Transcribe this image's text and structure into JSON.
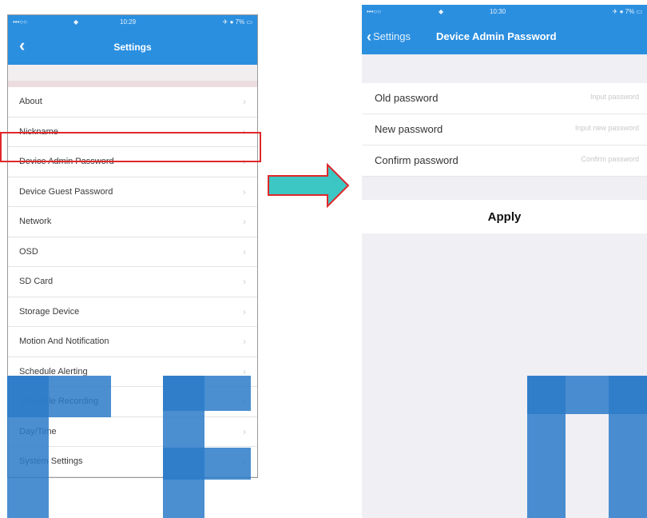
{
  "caption": "",
  "left_screen": {
    "status": {
      "carrier": "•••○○",
      "wifi": "◆",
      "time": "10:29",
      "battery": "✈ ● 7% ▭"
    },
    "nav": {
      "title": "Settings"
    },
    "items": [
      {
        "label": "About"
      },
      {
        "label": "Nickname"
      },
      {
        "label": "Device Admin Password"
      },
      {
        "label": "Device Guest Password"
      },
      {
        "label": "Network"
      },
      {
        "label": "OSD"
      },
      {
        "label": "SD Card"
      },
      {
        "label": "Storage Device"
      },
      {
        "label": "Motion And Notification"
      },
      {
        "label": "Schedule Alerting"
      },
      {
        "label": "Schedule Recording"
      },
      {
        "label": "Day/Time"
      },
      {
        "label": "System Settings"
      }
    ],
    "highlighted_item": "Device Admin Password"
  },
  "right_screen": {
    "status": {
      "carrier": "•••○○",
      "wifi": "◆",
      "time": "10:30",
      "battery": "✈ ● 7% ▭"
    },
    "nav": {
      "back_label": "Settings",
      "title": "Device Admin Password"
    },
    "fields": [
      {
        "label": "Old password",
        "placeholder": "Input password"
      },
      {
        "label": "New password",
        "placeholder": "Input new password"
      },
      {
        "label": "Confirm password",
        "placeholder": "Confirm password"
      }
    ],
    "apply_label": "Apply"
  },
  "colors": {
    "nav_blue": "#2b8fe0",
    "highlight_red": "#e0282a",
    "arrow_teal": "#3cc6c4",
    "arrow_outline": "#e0282a",
    "watermark_blue": "#2c7bc9"
  },
  "icons": {
    "back": "chevron-left-icon",
    "disclosure": "chevron-right-icon",
    "arrow": "right-arrow-icon"
  }
}
